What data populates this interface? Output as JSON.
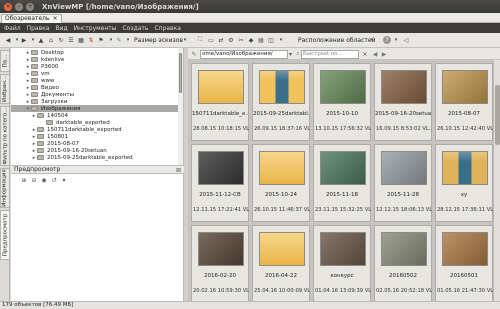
{
  "window": {
    "title": "XnViewMP [/home/vano/Изображения/]"
  },
  "tab": {
    "label": "Обозреватель"
  },
  "menu": [
    "Файл",
    "Правка",
    "Вид",
    "Инструменты",
    "Создать",
    "Справка"
  ],
  "toolbar": {
    "thumb_size_label": "Размер эскизов",
    "layout_label": "Расположение областей"
  },
  "left_tabs": [
    "Па...",
    "Избран...",
    "Фильтр по катего...",
    "Информация",
    "Предпросмотр"
  ],
  "tree": [
    {
      "label": "Desktop",
      "level": 1,
      "arrow": "▸"
    },
    {
      "label": "kdenlive",
      "level": 1,
      "arrow": "▸"
    },
    {
      "label": "P3600",
      "level": 1,
      "arrow": "▸"
    },
    {
      "label": "vm",
      "level": 1,
      "arrow": "▸"
    },
    {
      "label": "www",
      "level": 1,
      "arrow": "▸"
    },
    {
      "label": "Видео",
      "level": 1,
      "arrow": "▸"
    },
    {
      "label": "Документы",
      "level": 1,
      "arrow": "▸"
    },
    {
      "label": "Загрузки",
      "level": 1,
      "arrow": "▸"
    },
    {
      "label": "Изображения",
      "level": 1,
      "arrow": "▾",
      "selected": true
    },
    {
      "label": "140504",
      "level": 2,
      "arrow": "▸"
    },
    {
      "label": "darktable_exported",
      "level": 3,
      "arrow": ""
    },
    {
      "label": "150711darktable_exported",
      "level": 2,
      "arrow": "▸"
    },
    {
      "label": "150801",
      "level": 2,
      "arrow": "▸"
    },
    {
      "label": "2015-08-07",
      "level": 2,
      "arrow": "▸"
    },
    {
      "label": "2015-09-16-20setuan",
      "level": 2,
      "arrow": "▸"
    },
    {
      "label": "2015-09-25darktable_exported",
      "level": 2,
      "arrow": "▸"
    }
  ],
  "preview": {
    "title": "Предпросмотр"
  },
  "address": {
    "value": "ome/vano/Изображения/",
    "filter_placeholder": "Быстрый по..."
  },
  "thumbnails": [
    {
      "label": "150711darktable_e...",
      "date": "28.08.15 10:18:15 VL...",
      "color": "#f2c25c",
      "kind": "folder"
    },
    {
      "label": "2015-09-25darktabl...",
      "date": "26.09.15 18:37:16 VL...",
      "color": "#f2c25c",
      "kind": "folder-photo"
    },
    {
      "label": "2015-10-10",
      "date": "13.10.15 17:56:32 VL...",
      "color": "#6a8f5e",
      "kind": "photo"
    },
    {
      "label": "2015-09-16-20setuan",
      "date": "16.09.15 8:53:02 VL...",
      "color": "#8a6547",
      "kind": "photo"
    },
    {
      "label": "2015-08-07",
      "date": "26.10.15 12:42:40 VL...",
      "color": "#c49a52",
      "kind": "photo"
    },
    {
      "label": "2015-11-12-CB",
      "date": "12.11.15 17:21:41 VL...",
      "color": "#3b3b3b",
      "kind": "photo"
    },
    {
      "label": "2015-10-24",
      "date": "26.10.15 11:46:37 VL...",
      "color": "#f2c25c",
      "kind": "folder"
    },
    {
      "label": "2015-11-18",
      "date": "23.11.15 15:32:25 VL...",
      "color": "#4f7a63",
      "kind": "photo"
    },
    {
      "label": "2015-11-28",
      "date": "12.12.15 18:06:13 VL...",
      "color": "#9aa0a8",
      "kind": "photo"
    },
    {
      "label": "xy",
      "date": "28.12.15 17:36:11 VL...",
      "color": "#e0b35a",
      "kind": "folder-photo"
    },
    {
      "label": "2016-02-20",
      "date": "20.02.16 10:59:30 VL...",
      "color": "#5b4a3a",
      "kind": "photo"
    },
    {
      "label": "2016-04-22",
      "date": "25.04.16 10:00:09 VL...",
      "color": "#f2c25c",
      "kind": "folder"
    },
    {
      "label": "конкурс",
      "date": "01.04.16 13:09:39 VL...",
      "color": "#6e5a4a",
      "kind": "photo"
    },
    {
      "label": "20160502",
      "date": "02.05.16 20:52:18 VL...",
      "color": "#8b8f7c",
      "kind": "photo"
    },
    {
      "label": "20160501",
      "date": "01.05.16 21:47:30 VL...",
      "color": "#b07a45",
      "kind": "photo"
    }
  ],
  "status": {
    "text": "179 объектов [76.49 МБ]"
  }
}
